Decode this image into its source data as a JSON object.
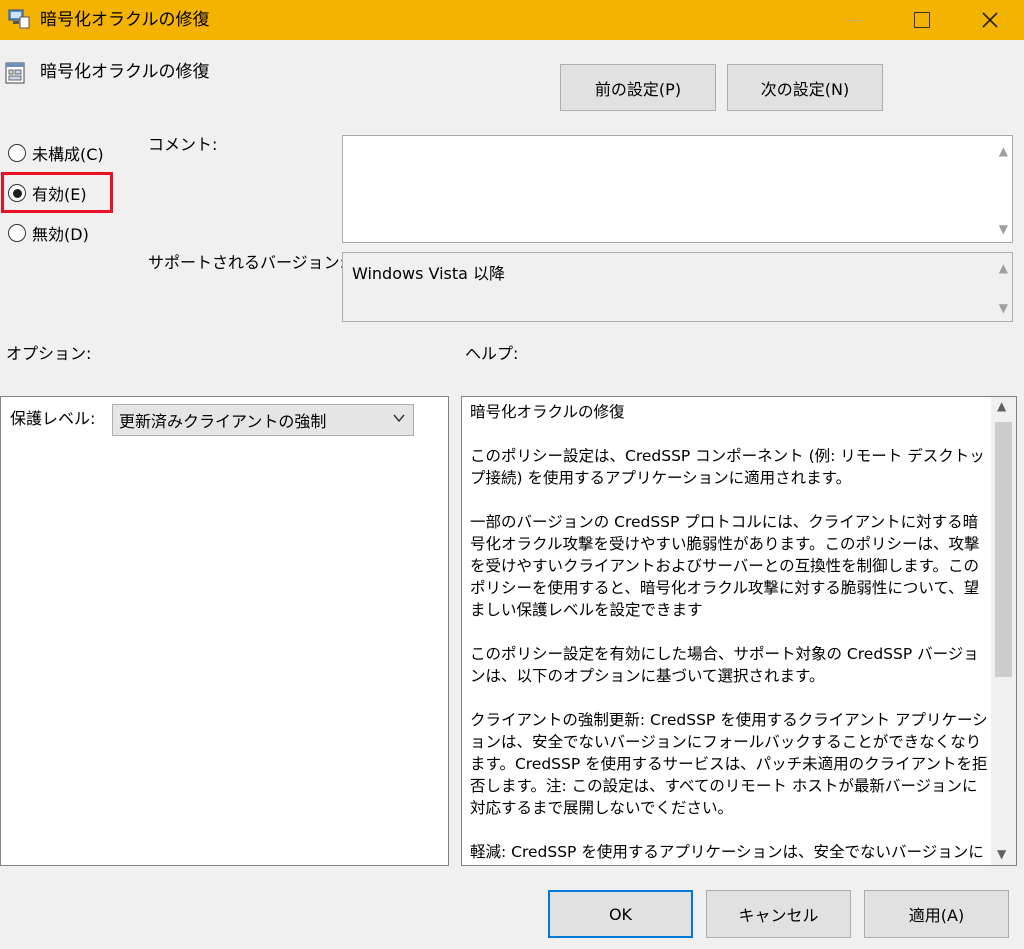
{
  "window": {
    "title": "暗号化オラクルの修復",
    "accent_color": "#f5b301",
    "icons": {
      "app": "policy-app-icon",
      "minimize": "minimize-icon",
      "maximize": "maximize-icon",
      "close": "close-icon"
    }
  },
  "header": {
    "policy_title": "暗号化オラクルの修復",
    "prev_button": "前の設定(P)",
    "next_button": "次の設定(N)"
  },
  "state": {
    "options": [
      {
        "label": "未構成(C)",
        "selected": false
      },
      {
        "label": "有効(E)",
        "selected": true
      },
      {
        "label": "無効(D)",
        "selected": false
      }
    ],
    "highlight_color": "#e81123"
  },
  "comment": {
    "label": "コメント:",
    "value": ""
  },
  "supported": {
    "label": "サポートされるバージョン:",
    "value": "Windows Vista 以降"
  },
  "options_section": {
    "label": "オプション:",
    "protection_label": "保護レベル:",
    "protection_value": "更新済みクライアントの強制"
  },
  "help_section": {
    "label": "ヘルプ:",
    "paragraphs": [
      "暗号化オラクルの修復",
      "このポリシー設定は、CredSSP コンポーネント (例: リモート デスクトップ接続) を使用するアプリケーションに適用されます。",
      "一部のバージョンの CredSSP プロトコルには、クライアントに対する暗号化オラクル攻撃を受けやすい脆弱性があります。このポリシーは、攻撃を受けやすいクライアントおよびサーバーとの互換性を制御します。このポリシーを使用すると、暗号化オラクル攻撃に対する脆弱性について、望ましい保護レベルを設定できます",
      "このポリシー設定を有効にした場合、サポート対象の CredSSP バージョンは、以下のオプションに基づいて選択されます。",
      "クライアントの強制更新: CredSSP を使用するクライアント アプリケーションは、安全でないバージョンにフォールバックすることができなくなります。CredSSP を使用するサービスは、パッチ未適用のクライアントを拒否します。注: この設定は、すべてのリモート ホストが最新バージョンに対応するまで展開しないでください。",
      "軽減: CredSSP を使用するアプリケーションは、安全でないバージョンにフ"
    ]
  },
  "footer": {
    "ok": "OK",
    "cancel": "キャンセル",
    "apply": "適用(A)"
  }
}
